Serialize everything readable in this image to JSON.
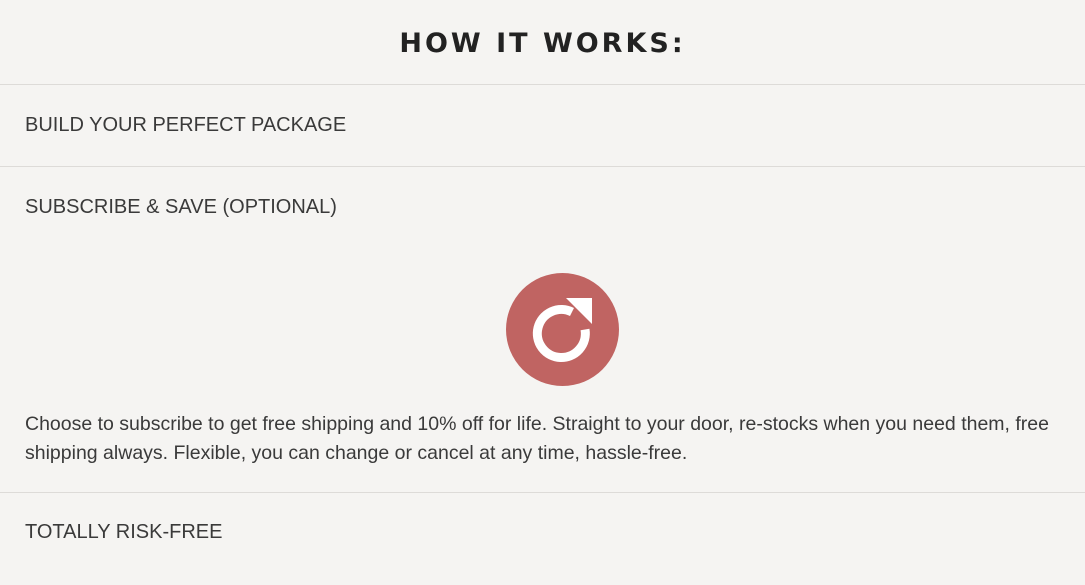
{
  "header": {
    "title": "HOW IT WORKS:"
  },
  "sections": [
    {
      "heading": "BUILD YOUR PERFECT PACKAGE"
    },
    {
      "heading": "SUBSCRIBE & SAVE (OPTIONAL)",
      "icon": "refresh-icon",
      "icon_color": "#c06462",
      "body": "Choose to subscribe to get free shipping and 10% off for life. Straight to your door, re-stocks when you need them, free shipping always. Flexible, you can change or cancel at any time, hassle-free."
    },
    {
      "heading": "TOTALLY RISK-FREE"
    }
  ]
}
